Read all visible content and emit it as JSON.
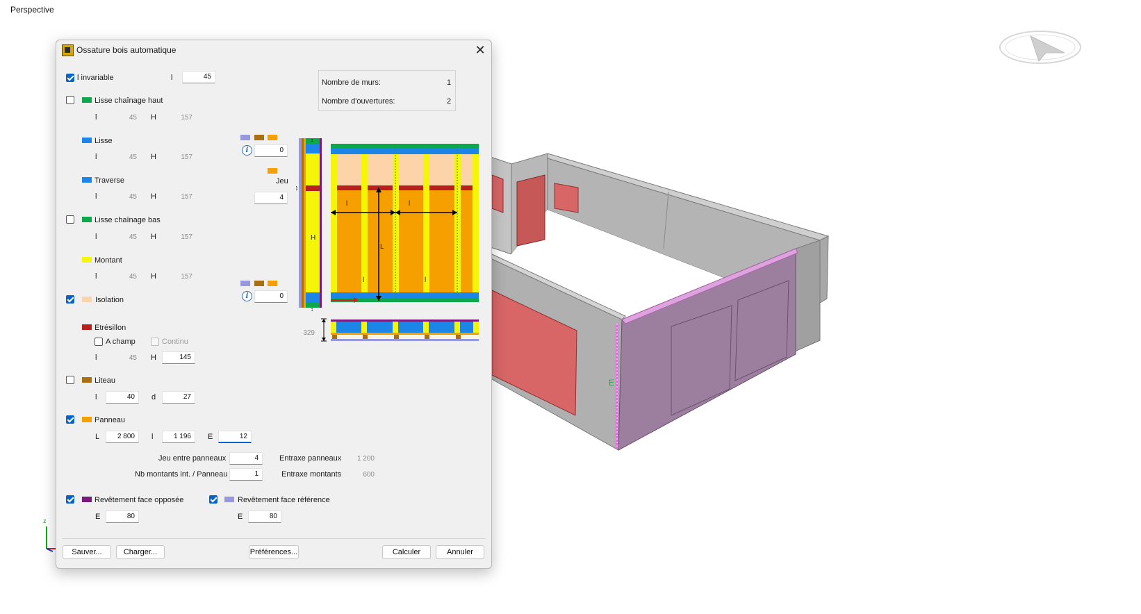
{
  "viewport": {
    "label": "Perspective"
  },
  "dialog": {
    "title": "Ossature bois automatique",
    "close_glyph": "✕",
    "l_invariable": {
      "label": "l invariable",
      "checked": true,
      "l_label": "l",
      "l_value": "45"
    },
    "lisse_chainage_haut": {
      "label": "Lisse chaînage haut",
      "checked": false,
      "color": "#0ea84c",
      "l_label": "l",
      "l_value": "45",
      "h_label": "H",
      "h_value": "157"
    },
    "lisse": {
      "label": "Lisse",
      "color": "#1c86e8",
      "l_label": "l",
      "l_value": "45",
      "h_label": "H",
      "h_value": "157"
    },
    "traverse": {
      "label": "Traverse",
      "color": "#1c86e8",
      "l_label": "l",
      "l_value": "45",
      "h_label": "H",
      "h_value": "157"
    },
    "lisse_chainage_bas": {
      "label": "Lisse chaînage bas",
      "checked": false,
      "color": "#0ea84c",
      "l_label": "l",
      "l_value": "45",
      "h_label": "H",
      "h_value": "157"
    },
    "montant": {
      "label": "Montant",
      "color": "#f5f50a",
      "l_label": "l",
      "l_value": "45",
      "h_label": "H",
      "h_value": "157"
    },
    "isolation": {
      "label": "Isolation",
      "checked": true,
      "color": "#fdd4aa"
    },
    "etresillon": {
      "label": "Etrésillon",
      "color": "#b82020",
      "a_champ": {
        "label": "A champ",
        "checked": false
      },
      "continu": {
        "label": "Continu",
        "checked": false
      },
      "l_label": "l",
      "l_value": "45",
      "h_label": "H",
      "h_value": "145"
    },
    "liteau": {
      "label": "Liteau",
      "checked": false,
      "color": "#a87010",
      "l_label": "l",
      "l_value": "40",
      "d_label": "d",
      "d_value": "27"
    },
    "panneau": {
      "label": "Panneau",
      "checked": true,
      "color": "#f5a000",
      "L_label": "L",
      "L_value": "2 800",
      "l_label": "l",
      "l_value": "1 196",
      "E_label": "E",
      "E_value": "12"
    },
    "jeu_entre_panneaux": {
      "label": "Jeu entre panneaux",
      "value": "4"
    },
    "nb_montants": {
      "label": "Nb montants int. / Panneau",
      "value": "1"
    },
    "entraxe_panneaux": {
      "label": "Entraxe panneaux",
      "value": "1 200"
    },
    "entraxe_montants": {
      "label": "Entraxe montants",
      "value": "600"
    },
    "revetement_opposee": {
      "label": "Revêtement face opposée",
      "checked": true,
      "color": "#7a1a7a",
      "E_label": "E",
      "E_value": "80"
    },
    "revetement_reference": {
      "label": "Revêtement face référence",
      "checked": true,
      "color": "#9898e0",
      "E_label": "E",
      "E_value": "80"
    },
    "info": {
      "murs_label": "Nombre de murs:",
      "murs_value": "1",
      "ouvertures_label": "Nombre d'ouvertures:",
      "ouvertures_value": "2"
    },
    "diagram": {
      "top_offset_value": "0",
      "jeu_label": "Jeu",
      "jeu_value": "4",
      "bottom_offset_value": "0",
      "section_value": "329",
      "l_mark": "l",
      "L_mark": "L",
      "H_mark": "H"
    },
    "buttons": {
      "save": "Sauver...",
      "load": "Charger...",
      "prefs": "Préférences...",
      "calc": "Calculer",
      "cancel": "Annuler"
    }
  },
  "axis": {
    "z_label": "z"
  },
  "model_marker": {
    "label": "E"
  }
}
